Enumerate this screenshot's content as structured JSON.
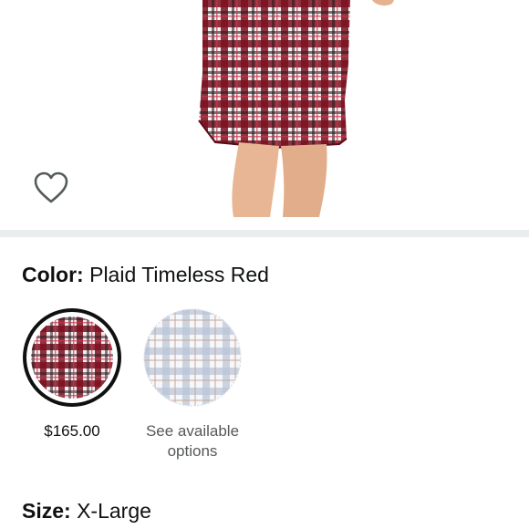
{
  "product_image": {
    "alt": ""
  },
  "wishlist": {
    "icon": "heart-outline-icon"
  },
  "color": {
    "label": "Color:",
    "value": "Plaid Timeless Red",
    "options": [
      {
        "price": "$165.00",
        "selected": true,
        "pattern": "red-plaid"
      },
      {
        "caption_line1": "See available",
        "caption_line2": "options",
        "selected": false,
        "pattern": "blue-grey-plaid"
      }
    ]
  },
  "size": {
    "label": "Size:",
    "value": "X-Large"
  },
  "colors": {
    "selected_ring": "#0f1111",
    "red_plaid": "#8b1a2b",
    "grey_plaid": "#b9c3d6"
  }
}
